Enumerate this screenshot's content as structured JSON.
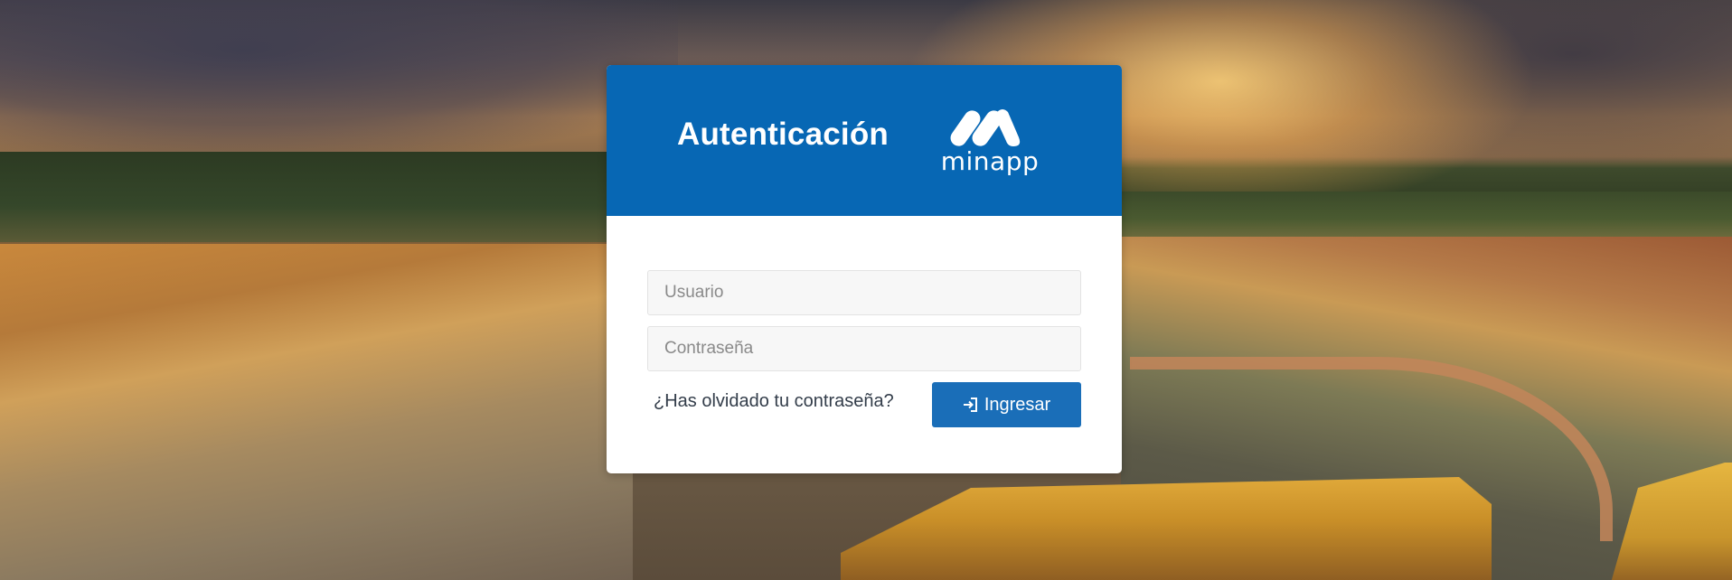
{
  "header": {
    "title": "Autenticación",
    "logo_text": "minapp"
  },
  "form": {
    "username_placeholder": "Usuario",
    "username_value": "",
    "password_placeholder": "Contraseña",
    "password_value": "",
    "forgot_link": "¿Has olvidado tu contraseña?",
    "submit_label": "Ingresar",
    "submit_icon": "sign-in-icon"
  },
  "colors": {
    "header_bg": "#0767b4",
    "button_bg": "#1a6eb8",
    "field_bg": "#f7f7f7",
    "text": "#333d4a"
  },
  "background": {
    "scene": "open-pit-mine-landscape"
  }
}
